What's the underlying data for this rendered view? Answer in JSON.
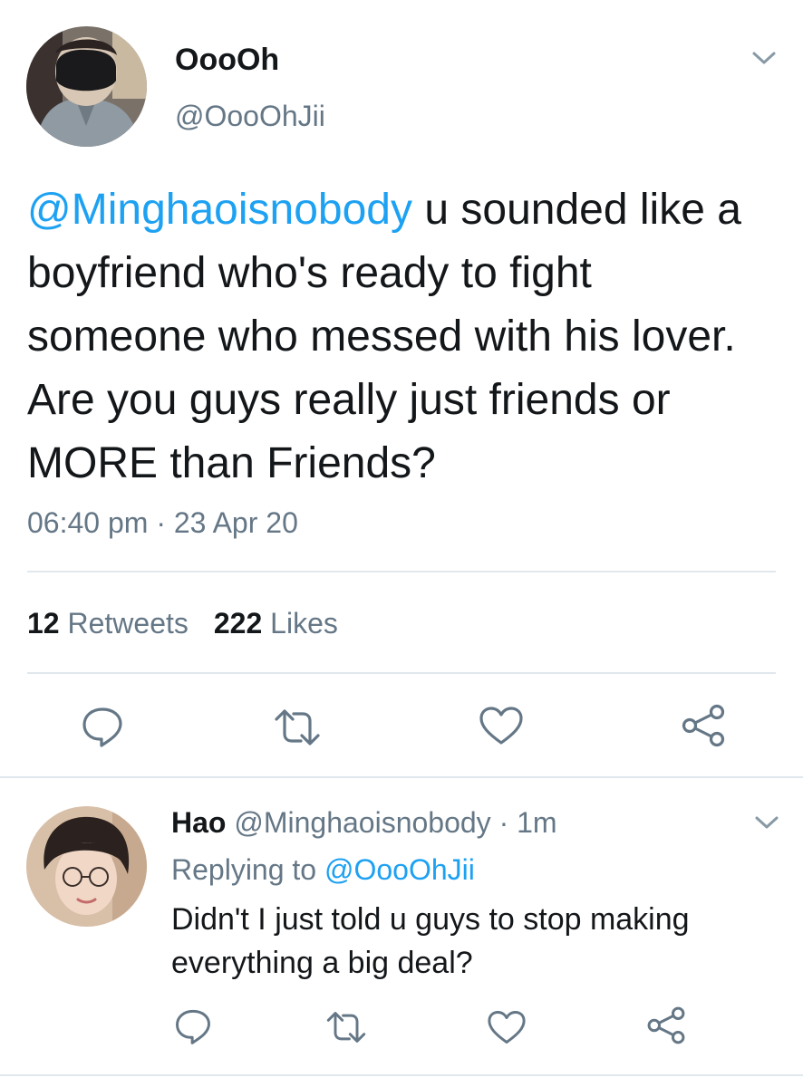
{
  "main_tweet": {
    "display_name": "OooOh",
    "handle": "@OooOhJii",
    "mention": "@Minghaoisnobody",
    "body": " u sounded like a boyfriend who's ready to fight someone who messed with his lover. Are you guys really just friends or MORE than Friends?",
    "time": "06:40 pm",
    "date_separator": " · ",
    "date": "23 Apr 20",
    "retweet_count": "12",
    "retweet_label": "Retweets",
    "like_count": "222",
    "like_label": "Likes",
    "menu_icon": "chevron-down-icon",
    "actions": [
      "reply-icon",
      "retweet-icon",
      "like-icon",
      "share-icon"
    ]
  },
  "reply_tweet": {
    "display_name": "Hao",
    "handle": "@Minghaoisnobody",
    "separator": " · ",
    "age": "1m",
    "replying_prefix": "Replying to ",
    "replying_to": "@OooOhJii",
    "body": "Didn't I just told u guys to stop making everything a big deal?",
    "menu_icon": "chevron-down-icon",
    "actions": [
      "reply-icon",
      "retweet-icon",
      "like-icon",
      "share-icon"
    ]
  },
  "colors": {
    "text_primary": "#14171a",
    "text_secondary": "#657786",
    "link": "#1da1f2",
    "divider": "#e1e8ed"
  }
}
